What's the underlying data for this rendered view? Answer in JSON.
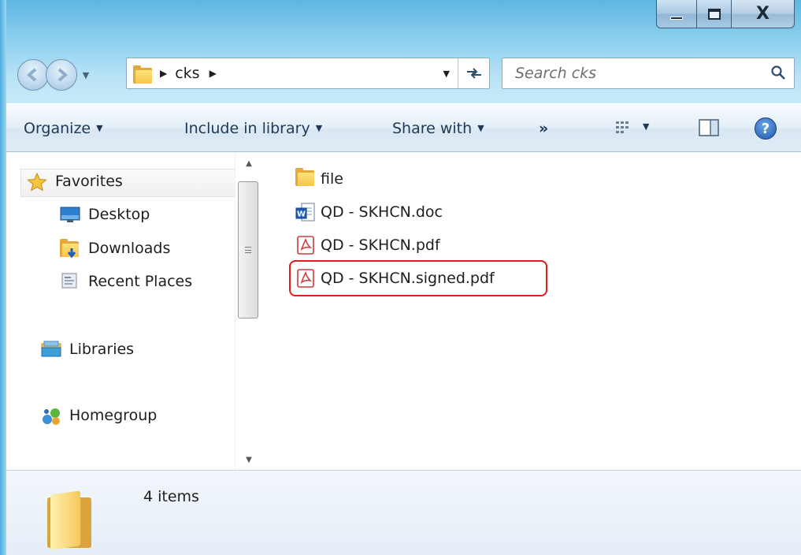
{
  "window": {
    "caption": {
      "close_label": "X"
    }
  },
  "address": {
    "path": [
      "cks"
    ],
    "search_placeholder": "Search cks"
  },
  "toolbar": {
    "organize": "Organize",
    "include_in_library": "Include in library",
    "share_with": "Share with",
    "more": "»",
    "help": "?"
  },
  "nav": {
    "favorites": "Favorites",
    "desktop": "Desktop",
    "downloads": "Downloads",
    "recent_places": "Recent Places",
    "libraries": "Libraries",
    "homegroup": "Homegroup"
  },
  "files": [
    {
      "name": "file",
      "type": "folder"
    },
    {
      "name": "QD - SKHCN.doc",
      "type": "word-document"
    },
    {
      "name": "QD - SKHCN.pdf",
      "type": "pdf"
    },
    {
      "name": "QD - SKHCN.signed.pdf",
      "type": "pdf",
      "highlighted": true
    }
  ],
  "status": {
    "item_count": "4 items"
  },
  "colors": {
    "highlight_border": "#e21b1b",
    "chrome_blue": "#8fd0ef"
  }
}
